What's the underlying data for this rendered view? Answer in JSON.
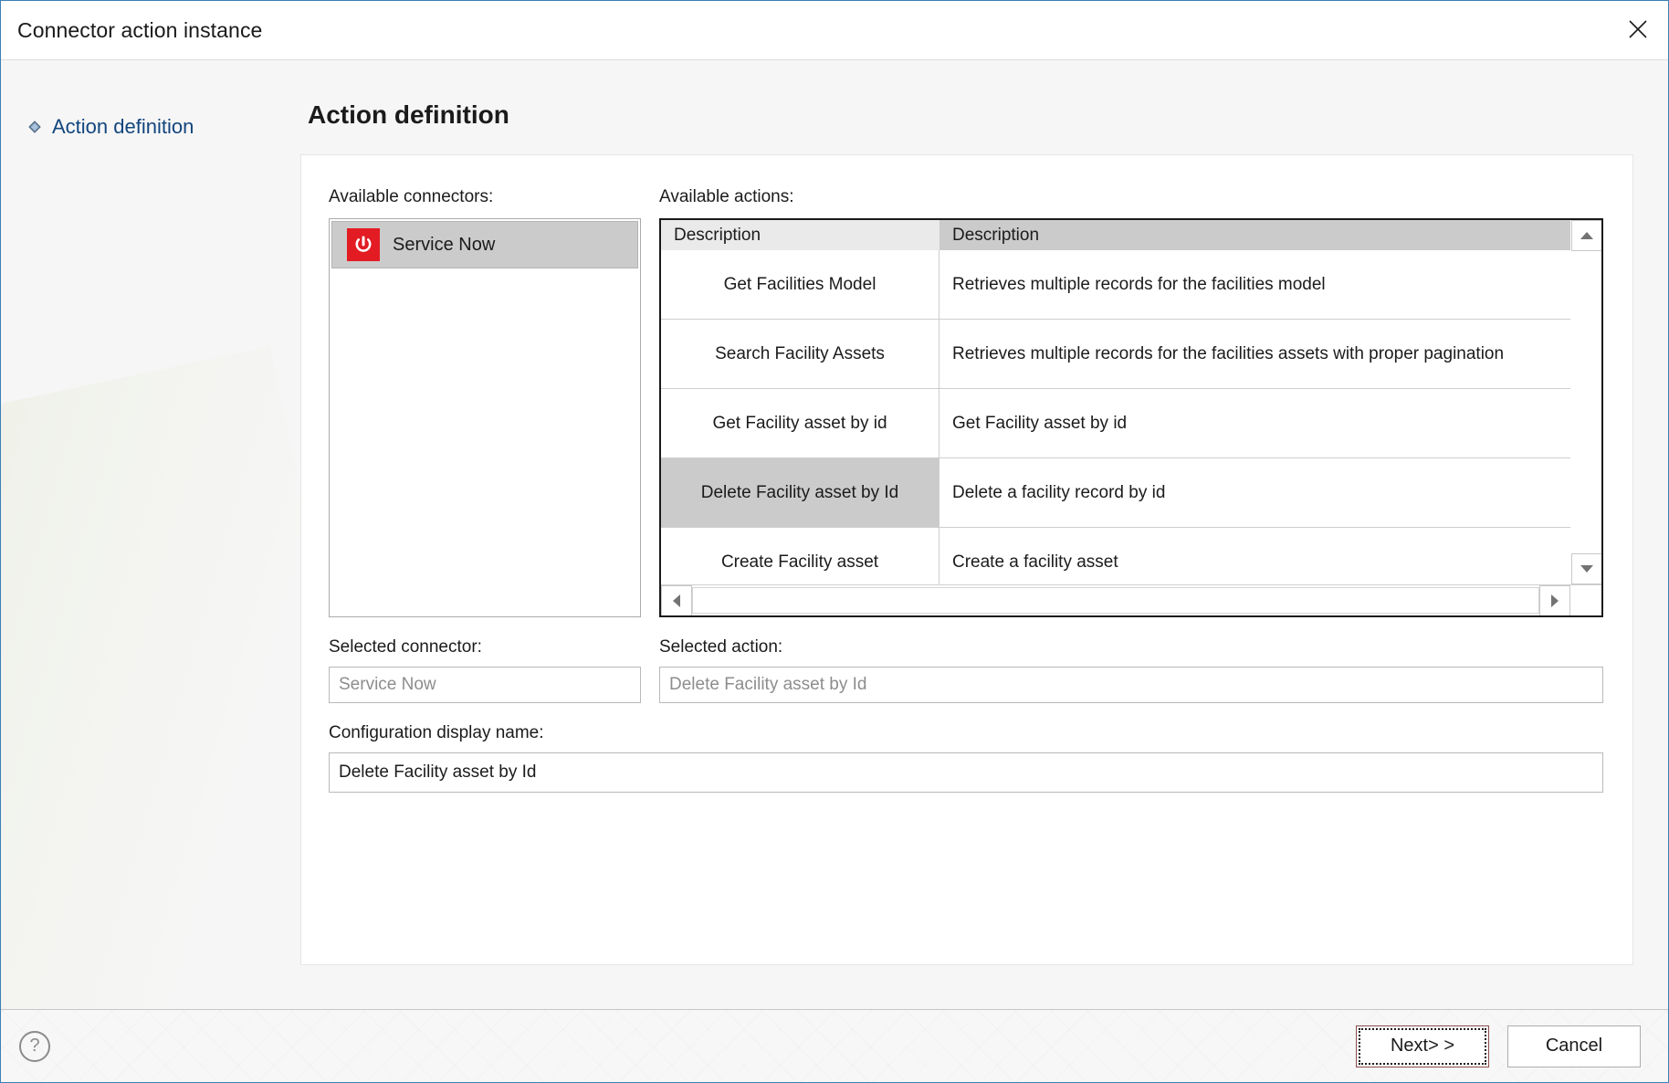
{
  "window": {
    "title": "Connector action instance",
    "close_icon": "close-icon"
  },
  "sidebar": {
    "items": [
      {
        "label": "Action definition",
        "icon": "diamond-bullet-icon",
        "active": true
      }
    ]
  },
  "page": {
    "heading": "Action definition"
  },
  "connectors": {
    "label": "Available connectors:",
    "items": [
      {
        "name": "Service Now",
        "icon": "power-icon",
        "icon_color": "#e31b23",
        "selected": true
      }
    ]
  },
  "actions": {
    "label": "Available actions:",
    "columns": [
      "Description",
      "Description"
    ],
    "rows": [
      {
        "name": "Get Facilities Model",
        "description": "Retrieves multiple records for the facilities model",
        "selected": false
      },
      {
        "name": "Search Facility Assets",
        "description": "Retrieves multiple records for the facilities assets with proper pagination",
        "selected": false
      },
      {
        "name": "Get Facility asset by id",
        "description": "Get Facility asset by id",
        "selected": false
      },
      {
        "name": "Delete Facility asset by Id",
        "description": "Delete a facility record by id",
        "selected": true
      },
      {
        "name": "Create Facility asset",
        "description": "Create a facility asset",
        "selected": false
      }
    ],
    "scrollbar": {
      "up_icon": "scroll-up-icon",
      "down_icon": "scroll-down-icon",
      "left_icon": "scroll-left-icon",
      "right_icon": "scroll-right-icon"
    }
  },
  "selected_connector": {
    "label": "Selected connector:",
    "value": "Service Now"
  },
  "selected_action": {
    "label": "Selected action:",
    "value": "Delete Facility asset by Id"
  },
  "config_name": {
    "label": "Configuration display name:",
    "value": "Delete Facility asset by Id"
  },
  "footer": {
    "help_icon": "help-icon",
    "next_label": "Next> >",
    "cancel_label": "Cancel"
  },
  "colors": {
    "window_border": "#3a7fb5",
    "nav_link": "#12457e",
    "selection_gray": "#cbcbcb",
    "brand_red": "#e31b23"
  }
}
